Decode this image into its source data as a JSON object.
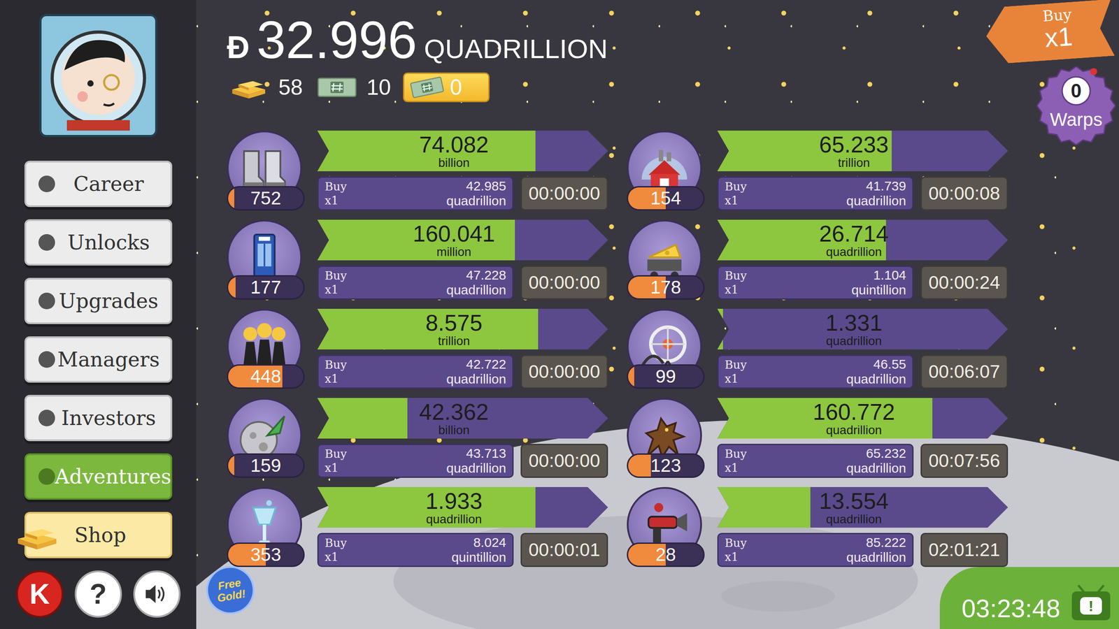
{
  "player": {
    "currency_symbol": "Ð",
    "cash": "32.996",
    "cash_unit": "QUADRILLION",
    "gold": "58",
    "megabucks": "10",
    "tickets": "0"
  },
  "buy_mode": {
    "label": "Buy",
    "value": "x1"
  },
  "warps": {
    "count": "0",
    "label": "Warps"
  },
  "sidebar": {
    "items": [
      {
        "label": "Career",
        "selected": false
      },
      {
        "label": "Unlocks",
        "selected": false
      },
      {
        "label": "Upgrades",
        "selected": false
      },
      {
        "label": "Managers",
        "selected": false
      },
      {
        "label": "Investors",
        "selected": false
      },
      {
        "label": "Adventures",
        "selected": true
      }
    ],
    "shop": "Shop"
  },
  "bottom_buttons": {
    "kongregate": "K",
    "help": "?"
  },
  "free_gold": "Free Gold!",
  "event_timer": {
    "time": "03:23:48",
    "alert": "!"
  },
  "businesses": [
    {
      "owned": "752",
      "owned_progress": 0.08,
      "revenue": "74.082",
      "revenue_unit": "billion",
      "progress": 0.75,
      "buy_label": "Buy",
      "buy_multiplier": "x1",
      "cost": "42.985",
      "cost_unit": "quadrillion",
      "time": "00:00:00"
    },
    {
      "owned": "177",
      "owned_progress": 0.1,
      "revenue": "160.041",
      "revenue_unit": "million",
      "progress": 0.68,
      "buy_label": "Buy",
      "buy_multiplier": "x1",
      "cost": "47.228",
      "cost_unit": "quadrillion",
      "time": "00:00:00"
    },
    {
      "owned": "448",
      "owned_progress": 0.72,
      "revenue": "8.575",
      "revenue_unit": "trillion",
      "progress": 0.76,
      "buy_label": "Buy",
      "buy_multiplier": "x1",
      "cost": "42.722",
      "cost_unit": "quadrillion",
      "time": "00:00:00"
    },
    {
      "owned": "159",
      "owned_progress": 0.08,
      "revenue": "42.362",
      "revenue_unit": "billion",
      "progress": 0.31,
      "buy_label": "Buy",
      "buy_multiplier": "x1",
      "cost": "43.713",
      "cost_unit": "quadrillion",
      "time": "00:00:00"
    },
    {
      "owned": "353",
      "owned_progress": 0.5,
      "revenue": "1.933",
      "revenue_unit": "quadrillion",
      "progress": 0.75,
      "buy_label": "Buy",
      "buy_multiplier": "x1",
      "cost": "8.024",
      "cost_unit": "quintillion",
      "time": "00:00:01"
    },
    {
      "owned": "154",
      "owned_progress": 0.5,
      "revenue": "65.233",
      "revenue_unit": "trillion",
      "progress": 0.6,
      "buy_label": "Buy",
      "buy_multiplier": "x1",
      "cost": "41.739",
      "cost_unit": "quadrillion",
      "time": "00:00:08"
    },
    {
      "owned": "178",
      "owned_progress": 0.5,
      "revenue": "26.714",
      "revenue_unit": "quadrillion",
      "progress": 0.58,
      "buy_label": "Buy",
      "buy_multiplier": "x1",
      "cost": "1.104",
      "cost_unit": "quintillion",
      "time": "00:00:24"
    },
    {
      "owned": "99",
      "owned_progress": 0.08,
      "revenue": "1.331",
      "revenue_unit": "quadrillion",
      "progress": 0.02,
      "buy_label": "Buy",
      "buy_multiplier": "x1",
      "cost": "46.55",
      "cost_unit": "quadrillion",
      "time": "00:06:07"
    },
    {
      "owned": "123",
      "owned_progress": 0.3,
      "revenue": "160.772",
      "revenue_unit": "quadrillion",
      "progress": 0.74,
      "buy_label": "Buy",
      "buy_multiplier": "x1",
      "cost": "65.232",
      "cost_unit": "quadrillion",
      "time": "00:07:56"
    },
    {
      "owned": "28",
      "owned_progress": 0.5,
      "revenue": "13.554",
      "revenue_unit": "quadrillion",
      "progress": 0.32,
      "buy_label": "Buy",
      "buy_multiplier": "x1",
      "cost": "85.222",
      "cost_unit": "quadrillion",
      "time": "02:01:21"
    }
  ]
}
